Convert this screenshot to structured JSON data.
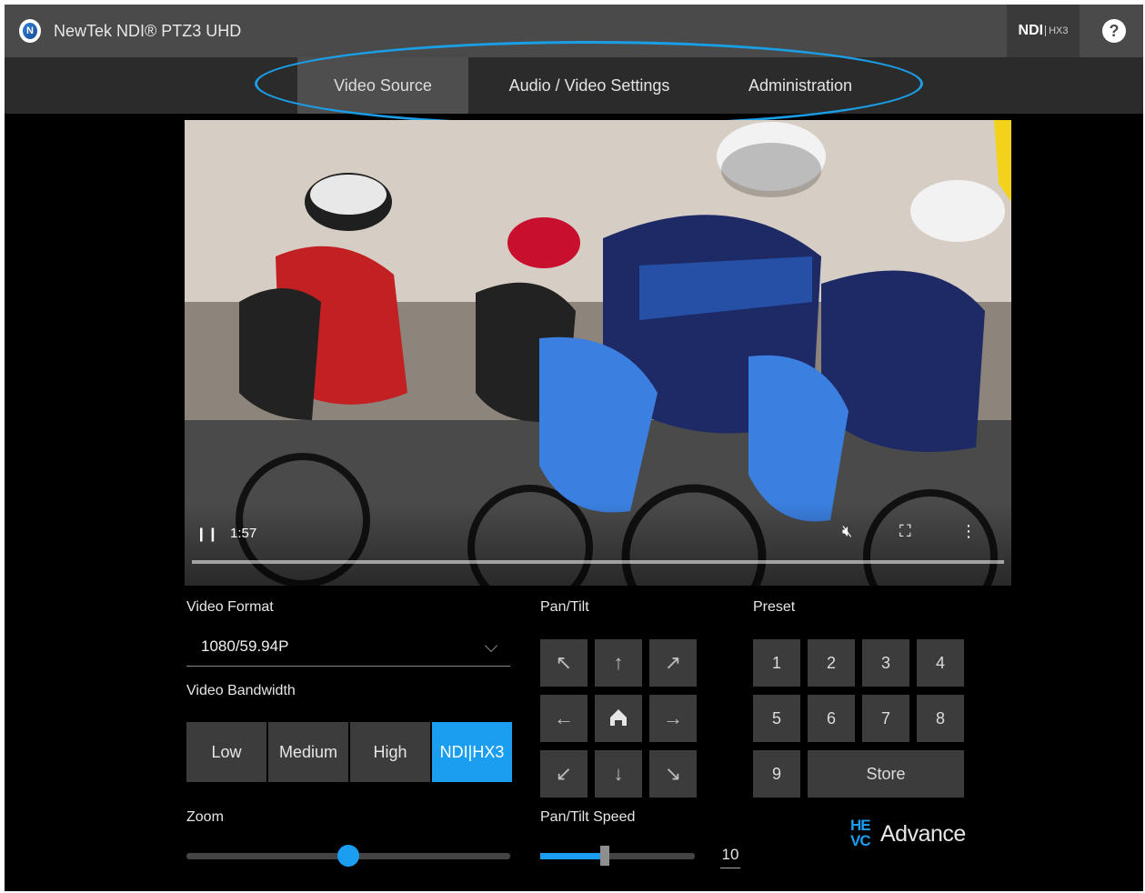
{
  "header": {
    "app_title": "NewTek NDI® PTZ3 UHD",
    "badge": "NDI",
    "badge_suffix": "HX3",
    "help": "?"
  },
  "tabs": [
    {
      "label": "Video Source",
      "active": true
    },
    {
      "label": "Audio / Video Settings",
      "active": false
    },
    {
      "label": "Administration",
      "active": false
    }
  ],
  "player": {
    "time": "1:57",
    "progress": 0.0
  },
  "video_format": {
    "label": "Video Format",
    "value": "1080/59.94P"
  },
  "bandwidth": {
    "label": "Video Bandwidth",
    "options": [
      "Low",
      "Medium",
      "High",
      "NDI|HX3"
    ],
    "selected": "NDI|HX3"
  },
  "zoom": {
    "label": "Zoom",
    "level": 0.5
  },
  "pan_tilt": {
    "label": "Pan/Tilt",
    "buttons": [
      "↖",
      "↑",
      "↗",
      "←",
      "home",
      "→",
      "↙",
      "↓",
      "↘"
    ]
  },
  "pan_tilt_speed": {
    "label": "Pan/Tilt Speed",
    "value": "10",
    "level": 0.42
  },
  "preset": {
    "label": "Preset",
    "numbers": [
      "1",
      "2",
      "3",
      "4",
      "5",
      "6",
      "7",
      "8",
      "9"
    ],
    "store_label": "Store"
  },
  "branding": {
    "hevc_mark": "HE VC",
    "hevc_text": "Advance"
  },
  "colors": {
    "accent": "#1b9ef0",
    "title_bar": "#4a4a4a",
    "tab_bar": "#2b2b2b",
    "button": "#3c3c3c"
  }
}
